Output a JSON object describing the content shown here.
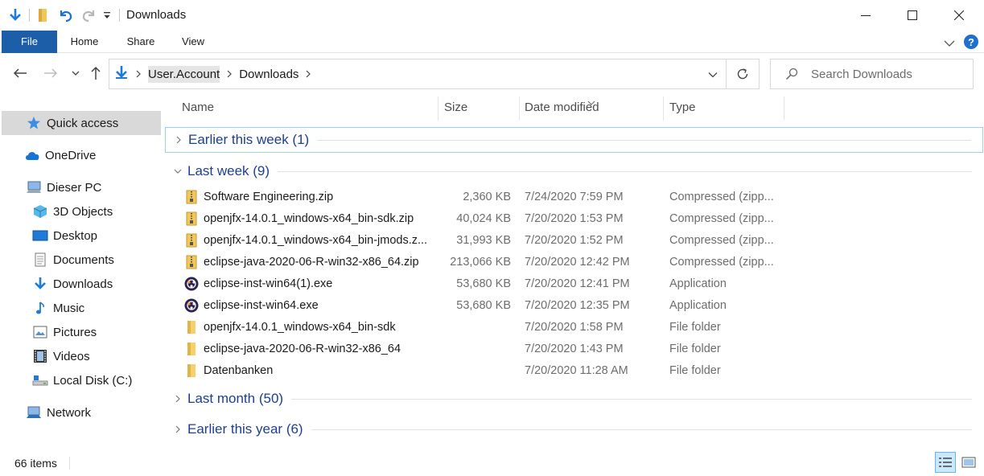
{
  "window": {
    "title": "Downloads",
    "minimize_label": "—",
    "maximize_label": "☐",
    "close_label": "✕"
  },
  "ribbon": {
    "tabs": [
      {
        "label": "File"
      },
      {
        "label": "Home"
      },
      {
        "label": "Share"
      },
      {
        "label": "View"
      }
    ]
  },
  "address": {
    "crumbs": [
      "User.Account",
      "Downloads"
    ],
    "search_placeholder": "Search Downloads"
  },
  "sidebar": {
    "items": [
      {
        "label": "Quick access",
        "icon": "star-icon"
      },
      {
        "label": "OneDrive",
        "icon": "cloud-icon"
      },
      {
        "label": "Dieser PC",
        "icon": "computer-icon"
      },
      {
        "label": "3D Objects",
        "icon": "cube-icon"
      },
      {
        "label": "Desktop",
        "icon": "desktop-icon"
      },
      {
        "label": "Documents",
        "icon": "document-icon"
      },
      {
        "label": "Downloads",
        "icon": "download-icon"
      },
      {
        "label": "Music",
        "icon": "music-icon"
      },
      {
        "label": "Pictures",
        "icon": "picture-icon"
      },
      {
        "label": "Videos",
        "icon": "video-icon"
      },
      {
        "label": "Local Disk (C:)",
        "icon": "disk-icon"
      },
      {
        "label": "Network",
        "icon": "network-icon"
      }
    ]
  },
  "columns": {
    "name": "Name",
    "size": "Size",
    "date": "Date modified",
    "type": "Type"
  },
  "groups": {
    "earlier_week": "Earlier this week (1)",
    "last_week": "Last week (9)",
    "last_month": "Last month (50)",
    "earlier_year": "Earlier this year (6)"
  },
  "files": [
    {
      "name": "Software Engineering.zip",
      "size": "2,360 KB",
      "date": "7/24/2020 7:59 PM",
      "type": "Compressed (zipp...",
      "icon": "zip-icon"
    },
    {
      "name": "openjfx-14.0.1_windows-x64_bin-sdk.zip",
      "size": "40,024 KB",
      "date": "7/20/2020 1:53 PM",
      "type": "Compressed (zipp...",
      "icon": "zip-icon"
    },
    {
      "name": "openjfx-14.0.1_windows-x64_bin-jmods.z...",
      "size": "31,993 KB",
      "date": "7/20/2020 1:52 PM",
      "type": "Compressed (zipp...",
      "icon": "zip-icon"
    },
    {
      "name": "eclipse-java-2020-06-R-win32-x86_64.zip",
      "size": "213,066 KB",
      "date": "7/20/2020 12:42 PM",
      "type": "Compressed (zipp...",
      "icon": "zip-icon"
    },
    {
      "name": "eclipse-inst-win64(1).exe",
      "size": "53,680 KB",
      "date": "7/20/2020 12:41 PM",
      "type": "Application",
      "icon": "eclipse-icon"
    },
    {
      "name": "eclipse-inst-win64.exe",
      "size": "53,680 KB",
      "date": "7/20/2020 12:35 PM",
      "type": "Application",
      "icon": "eclipse-icon"
    },
    {
      "name": "openjfx-14.0.1_windows-x64_bin-sdk",
      "size": "",
      "date": "7/20/2020 1:58 PM",
      "type": "File folder",
      "icon": "folder-icon"
    },
    {
      "name": "eclipse-java-2020-06-R-win32-x86_64",
      "size": "",
      "date": "7/20/2020 1:43 PM",
      "type": "File folder",
      "icon": "folder-icon"
    },
    {
      "name": "Datenbanken",
      "size": "",
      "date": "7/20/2020 11:28 AM",
      "type": "File folder",
      "icon": "folder-icon"
    }
  ],
  "status": {
    "count": "66 items"
  },
  "colors": {
    "accent": "#1d5ea8",
    "group_title": "#1e3e8f",
    "selected_bg": "#d9d9d9",
    "folder": "#f1c75b",
    "eclipse": "#2c2255"
  }
}
